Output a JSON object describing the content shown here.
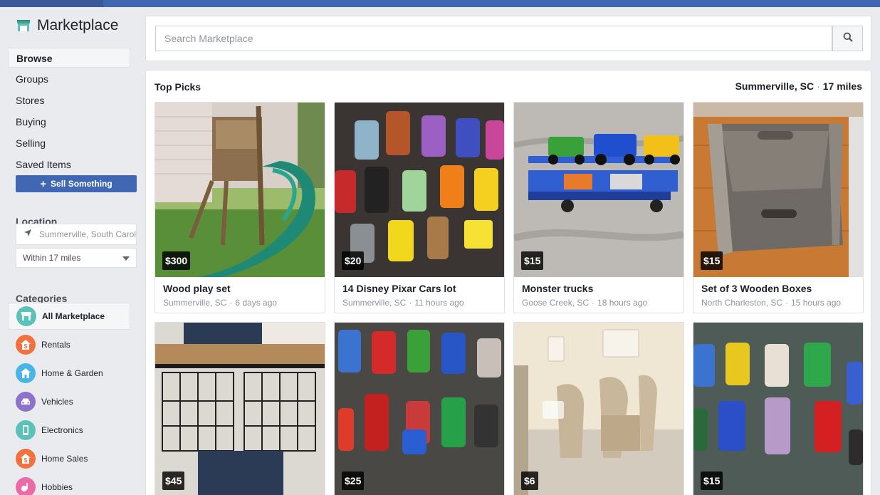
{
  "app": {
    "title": "Marketplace"
  },
  "nav": {
    "items": [
      {
        "label": "Browse",
        "active": true
      },
      {
        "label": "Groups"
      },
      {
        "label": "Stores"
      },
      {
        "label": "Buying"
      },
      {
        "label": "Selling"
      },
      {
        "label": "Saved Items"
      }
    ]
  },
  "sell_button": {
    "label": "Sell Something",
    "icon": "plus-icon"
  },
  "location": {
    "heading": "Location",
    "value": "Summerville, South Carol",
    "radius": "Within 17 miles"
  },
  "categories": {
    "heading": "Categories",
    "items": [
      {
        "label": "All Marketplace",
        "icon": "storefront-icon",
        "color": "#5bc2b9",
        "active": true
      },
      {
        "label": "Rentals",
        "icon": "rental-house-icon",
        "color": "#f3703f"
      },
      {
        "label": "Home & Garden",
        "icon": "house-icon",
        "color": "#47b5e6"
      },
      {
        "label": "Vehicles",
        "icon": "car-icon",
        "color": "#8c72cb"
      },
      {
        "label": "Electronics",
        "icon": "phone-icon",
        "color": "#5bc2b9"
      },
      {
        "label": "Home Sales",
        "icon": "home-sale-icon",
        "color": "#f3703f"
      },
      {
        "label": "Hobbies",
        "icon": "hobbies-icon",
        "color": "#ec6aa8"
      }
    ]
  },
  "search": {
    "placeholder": "Search Marketplace",
    "icon": "search-icon"
  },
  "feed": {
    "heading": "Top Picks",
    "location": "Summerville, SC",
    "distance": "17 miles"
  },
  "listings": [
    {
      "price": "$300",
      "title": "Wood play set",
      "location": "Summerville, SC",
      "time": "6 days ago"
    },
    {
      "price": "$20",
      "title": "14 Disney Pixar Cars lot",
      "location": "Summerville, SC",
      "time": "11 hours ago"
    },
    {
      "price": "$15",
      "title": "Monster trucks",
      "location": "Goose Creek, SC",
      "time": "18 hours ago"
    },
    {
      "price": "$15",
      "title": "Set of 3 Wooden Boxes",
      "location": "North Charleston, SC",
      "time": "15 hours ago"
    },
    {
      "price": "$45",
      "title": "",
      "location": "",
      "time": ""
    },
    {
      "price": "$25",
      "title": "",
      "location": "",
      "time": ""
    },
    {
      "price": "$6",
      "title": "",
      "location": "",
      "time": ""
    },
    {
      "price": "$15",
      "title": "",
      "location": "",
      "time": ""
    }
  ],
  "colors": {
    "brand_blue": "#4267b2",
    "background": "#e9ebee"
  }
}
